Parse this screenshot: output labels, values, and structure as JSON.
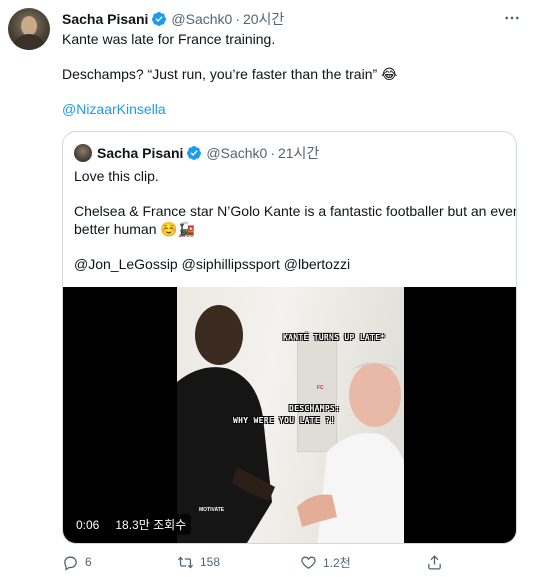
{
  "tweet": {
    "author_name": "Sacha Pisani",
    "handle": "@Sachk0",
    "separator": "·",
    "time": "20시간",
    "lines": [
      "Kante was late for France training.",
      "Deschamps? “Just run, you’re faster than the train” 😂"
    ],
    "mention": "@NizaarKinsella",
    "more_icon": "more-horizontal-icon",
    "verified_icon": "verified-badge-icon"
  },
  "quote": {
    "author_name": "Sacha Pisani",
    "handle": "@Sachk0",
    "separator": "·",
    "time": "21시간",
    "line1": "Love this clip.",
    "line2": "Chelsea & France star N’Golo Kante is a fantastic footballer but an even",
    "line3": "better human ☺️🚂",
    "mentions": "@Jon_LeGossip @siphillipssport @lbertozzi",
    "video": {
      "caption_top": "KANTÉ TURNS UP LATE*",
      "caption_mid_1": "DESCHAMPS:",
      "caption_mid_2": "WHY WERE YOU LATE ?!",
      "small_logo": "FC",
      "watermark": "MOTIVATE",
      "duration": "0:06",
      "views": "18.3만 조회수"
    }
  },
  "actions": {
    "reply_count": "6",
    "retweet_count": "158",
    "like_count": "1.2천",
    "reply_icon": "reply-icon",
    "retweet_icon": "retweet-icon",
    "like_icon": "heart-icon",
    "share_icon": "share-icon"
  },
  "colors": {
    "accent": "#1d9bf0",
    "secondary_text": "#536471",
    "border": "#cfd9de"
  }
}
